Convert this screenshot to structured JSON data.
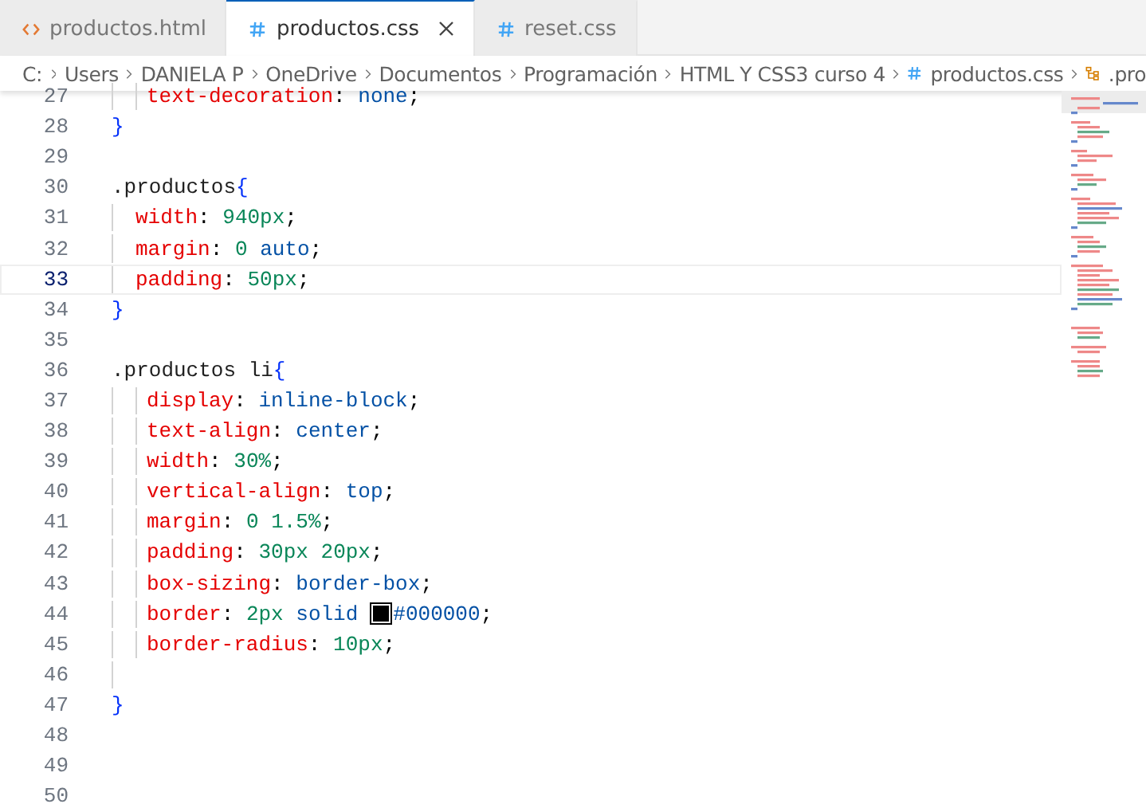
{
  "tabs": [
    {
      "label": "productos.html",
      "kind": "html",
      "selected": false,
      "closable": false
    },
    {
      "label": "productos.css",
      "kind": "css",
      "selected": true,
      "closable": true
    },
    {
      "label": "reset.css",
      "kind": "css",
      "selected": false,
      "closable": false
    }
  ],
  "breadcrumb": [
    {
      "label": "C:"
    },
    {
      "label": "Users"
    },
    {
      "label": "DANIELA P"
    },
    {
      "label": "OneDrive"
    },
    {
      "label": "Documentos"
    },
    {
      "label": "Programación"
    },
    {
      "label": "HTML Y CSS3 curso 4"
    },
    {
      "label": "productos.css",
      "kind": "css"
    },
    {
      "label": ".pro",
      "kind": "symbol"
    }
  ],
  "lines": [
    {
      "number": "27",
      "kind": "nested2",
      "current": false,
      "code": "text-decoration: none;"
    },
    {
      "number": "28",
      "kind": "top",
      "current": false,
      "code": "}"
    },
    {
      "number": "29",
      "kind": "top",
      "current": false
    },
    {
      "number": "30",
      "kind": "top",
      "current": false,
      "code": ".productos{"
    },
    {
      "number": "31",
      "kind": "nested",
      "current": false,
      "code": "width: 940px;"
    },
    {
      "number": "32",
      "kind": "nested",
      "current": false,
      "code": "margin: 0 auto;"
    },
    {
      "number": "33",
      "kind": "nested",
      "current": true,
      "code": "padding: 50px;"
    },
    {
      "number": "34",
      "kind": "top",
      "current": false,
      "code": "}"
    },
    {
      "number": "35",
      "kind": "top",
      "current": false
    },
    {
      "number": "36",
      "kind": "top",
      "current": false,
      "code": ".productos li{"
    },
    {
      "number": "37",
      "kind": "nested2",
      "current": false,
      "code": "display: inline-block;"
    },
    {
      "number": "38",
      "kind": "nested2",
      "current": false,
      "code": "text-align: center;"
    },
    {
      "number": "39",
      "kind": "nested2",
      "current": false,
      "code": "width: 30%;"
    },
    {
      "number": "40",
      "kind": "nested2",
      "current": false,
      "code": "vertical-align: top;"
    },
    {
      "number": "41",
      "kind": "nested2",
      "current": false,
      "code": "margin: 0 1.5%;"
    },
    {
      "number": "42",
      "kind": "nested2",
      "current": false,
      "code": "padding: 30px 20px;"
    },
    {
      "number": "43",
      "kind": "nested2",
      "current": false,
      "code": "box-sizing: border-box;"
    },
    {
      "number": "44",
      "kind": "nested2",
      "current": false,
      "code": "border: 2px solid",
      "code_after_swatch": "#000000;"
    },
    {
      "number": "45",
      "kind": "nested2",
      "current": false,
      "code": "border-radius: 10px;"
    },
    {
      "number": "46",
      "kind": "nested",
      "current": false
    },
    {
      "number": "47",
      "kind": "top",
      "current": false,
      "code": "}"
    },
    {
      "number": "48",
      "kind": "top",
      "current": false
    },
    {
      "number": "49",
      "kind": "top",
      "current": false
    },
    {
      "number": "50",
      "kind": "top",
      "current": false
    }
  ]
}
